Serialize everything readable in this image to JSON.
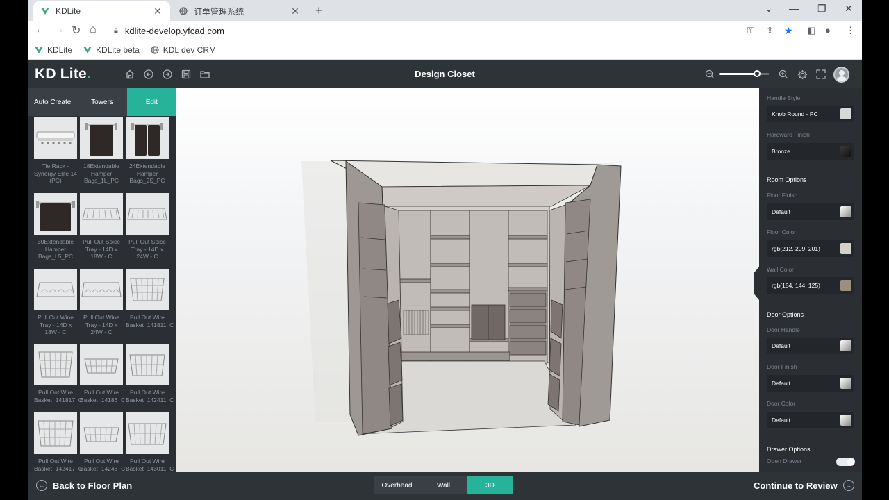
{
  "browser": {
    "tabs": [
      {
        "title": "KDLite",
        "active": true
      },
      {
        "title": "订单管理系统",
        "active": false
      }
    ],
    "url": "kdlite-develop.yfcad.com",
    "bookmarks": [
      "KDLite",
      "KDLite beta",
      "KDL dev CRM"
    ]
  },
  "header": {
    "logo": "KD Lite",
    "title": "Design Closet"
  },
  "left_panel": {
    "tabs": [
      "Auto Create",
      "Towers",
      "Edit"
    ],
    "active_tab": "Edit",
    "items": [
      "Tie Rack - Synergy Elite 14 (PC)",
      "18Extendable Hamper Bags_1L_PC",
      "24Extendable Hamper Bags_2S_PC",
      "30Extendable Hamper Bags_L5_PC",
      "Pull Out Spice Tray - 14D x 18W - C",
      "Pull Out Spice Tray - 14D x 24W - C",
      "Pull Out Wine Tray - 14D x 18W - C",
      "Pull Out Wine Tray - 14D x 24W - C",
      "Pull Out Wire Basket_141811_C",
      "Pull Out Wire Basket_141817_C",
      "Pull Out Wire Basket_14186_C",
      "Pull Out Wire Basket_142411_C",
      "Pull Out Wire Basket_142417_C",
      "Pull Out Wire Basket_14246_C",
      "Pull Out Wire Basket_143011_C"
    ]
  },
  "right_panel": {
    "handle_style_label": "Handle Style",
    "handle_style": "Knob Round - PC",
    "hardware_finish_label": "Hardware Finish",
    "hardware_finish": "Bronze",
    "room_options": "Room Options",
    "floor_finish_label": "Floor Finish",
    "floor_finish": "Default",
    "floor_color_label": "Floor Color",
    "floor_color": "rgb(212, 209, 201)",
    "wall_color_label": "Wall Color",
    "wall_color": "rgb(154, 144, 125)",
    "door_options": "Door Options",
    "door_handle_label": "Door Handle",
    "door_handle": "Default",
    "door_finish_label": "Door Finish",
    "door_finish": "Default",
    "door_color_label": "Door Color",
    "door_color": "Default",
    "drawer_options": "Drawer Options",
    "open_drawer_label": "Open Drawer",
    "open_drawer": true
  },
  "bottom": {
    "back": "Back to Floor Plan",
    "views": [
      "Overhead",
      "Wall",
      "3D"
    ],
    "active_view": "3D",
    "continue": "Continue to Review"
  },
  "colors": {
    "accent": "#27b39a",
    "panel": "#2b2f34",
    "header": "#2e3338",
    "floor_swatch": "#d4d1c9",
    "wall_swatch": "#9a907d"
  }
}
